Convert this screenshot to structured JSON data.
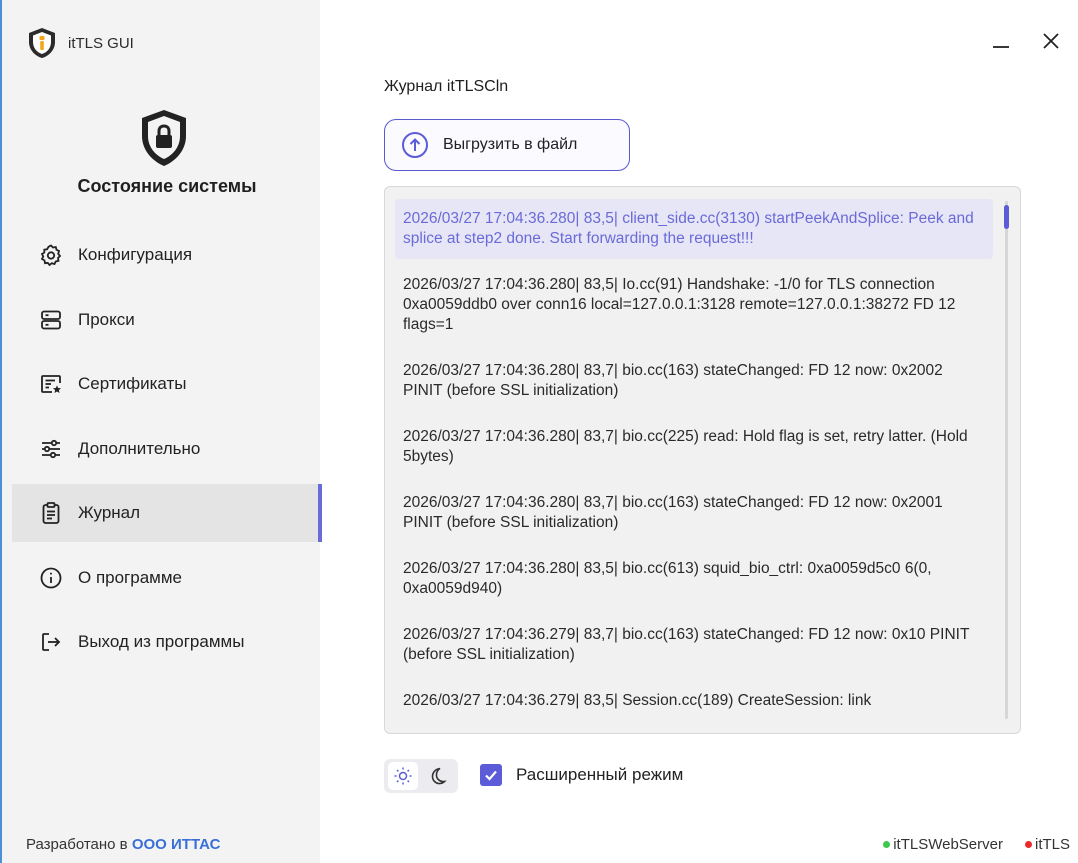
{
  "app": {
    "title": "itTLS GUI"
  },
  "sidebar": {
    "status_title": "Состояние системы",
    "items": [
      {
        "label": "Конфигурация",
        "icon": "gear-icon",
        "active": false
      },
      {
        "label": "Прокси",
        "icon": "server-icon",
        "active": false
      },
      {
        "label": "Сертификаты",
        "icon": "certificate-icon",
        "active": false
      },
      {
        "label": "Дополнительно",
        "icon": "sliders-icon",
        "active": false
      },
      {
        "label": "Журнал",
        "icon": "clipboard-icon",
        "active": true
      },
      {
        "label": "О программе",
        "icon": "info-icon",
        "active": false
      },
      {
        "label": "Выход из программы",
        "icon": "logout-icon",
        "active": false
      }
    ]
  },
  "footer": {
    "developed_prefix": "Разработано в",
    "company": "ООО ИТТАС",
    "services": [
      {
        "name": "itTLSWebServer",
        "color": "#3cc84a"
      },
      {
        "name": "itTLS",
        "color": "#e82a2a"
      }
    ]
  },
  "main": {
    "title": "Журнал itTLSCln",
    "export_button": "Выгрузить в файл",
    "log_entries": [
      "2026/03/27 17:04:36.280| 83,5| client_side.cc(3130) startPeekAndSplice: Peek and splice at step2 done. Start forwarding the request!!!",
      "2026/03/27 17:04:36.280| 83,5| Io.cc(91) Handshake: -1/0 for TLS connection 0xa0059ddb0 over conn16 local=127.0.0.1:3128 remote=127.0.0.1:38272 FD 12 flags=1",
      "2026/03/27 17:04:36.280| 83,7| bio.cc(163) stateChanged: FD 12 now: 0x2002 PINIT  (before SSL initialization)",
      "2026/03/27 17:04:36.280| 83,7| bio.cc(225) read: Hold flag is set, retry latter. (Hold 5bytes)",
      "2026/03/27 17:04:36.280| 83,7| bio.cc(163) stateChanged: FD 12 now: 0x2001 PINIT  (before SSL initialization)",
      "2026/03/27 17:04:36.280| 83,5| bio.cc(613) squid_bio_ctrl: 0xa0059d5c0 6(0, 0xa0059d940)",
      "2026/03/27 17:04:36.279| 83,7| bio.cc(163) stateChanged: FD 12 now: 0x10 PINIT  (before SSL initialization)",
      "2026/03/27 17:04:36.279| 83,5| Session.cc(189) CreateSession: link"
    ],
    "advanced_mode_label": "Расширенный режим",
    "advanced_mode_checked": true,
    "theme": "light"
  },
  "colors": {
    "accent": "#5c5cd8",
    "window_border": "#4a90d9"
  }
}
